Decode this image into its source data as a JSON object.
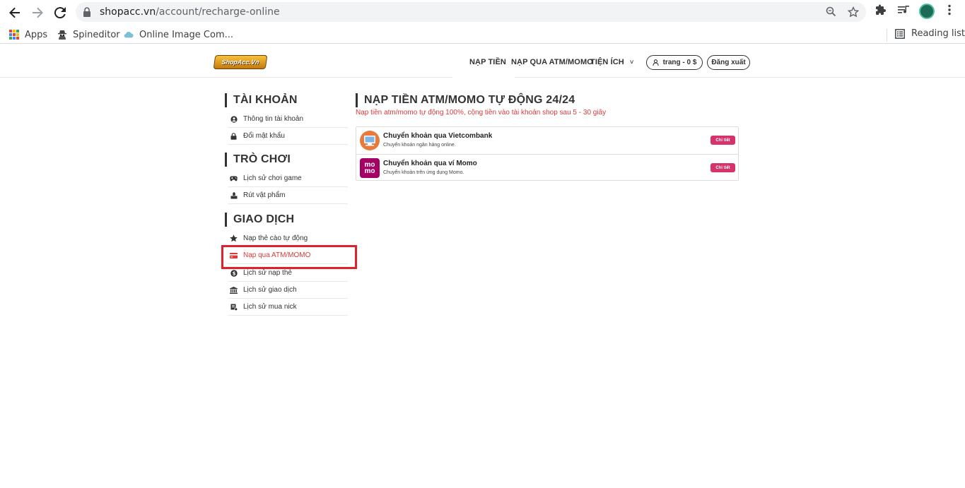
{
  "browser": {
    "url_host": "shopacc.vn",
    "url_path": "/account/recharge-online",
    "bookmarks": [
      {
        "label": "Apps"
      },
      {
        "label": "Spineditor"
      },
      {
        "label": "Online Image Com..."
      }
    ],
    "reading_list": "Reading list"
  },
  "header": {
    "logo_text": "ShopAcc.Vn",
    "menu": [
      {
        "label": "NẠP TIỀN"
      },
      {
        "label": "NẠP QUA ATM/MOMO"
      },
      {
        "label": "TIỆN ÍCH"
      }
    ],
    "tienich_caret": "˅",
    "user_label": "trang - 0 $",
    "logout_label": "Đăng xuất"
  },
  "sidebar": {
    "sections": [
      {
        "title": "TÀI KHOẢN",
        "items": [
          {
            "label": "Thông tin tài khoản",
            "icon": "user-circle-icon"
          },
          {
            "label": "Đổi mật khẩu",
            "icon": "lock-icon"
          }
        ]
      },
      {
        "title": "TRÒ CHƠI",
        "items": [
          {
            "label": "Lịch sử chơi game",
            "icon": "gamepad-icon"
          },
          {
            "label": "Rút vật phẩm",
            "icon": "withdraw-icon"
          }
        ]
      },
      {
        "title": "GIAO DỊCH",
        "items": [
          {
            "label": "Nạp thẻ cào tự động",
            "icon": "star-icon"
          },
          {
            "label": "Nạp qua ATM/MOMO",
            "icon": "credit-card-icon",
            "active": true
          },
          {
            "label": "Lịch sử nạp thẻ",
            "icon": "dollar-circle-icon"
          },
          {
            "label": "Lịch sử giao dịch",
            "icon": "bank-icon"
          },
          {
            "label": "Lịch sử mua nick",
            "icon": "cart-icon"
          }
        ]
      }
    ]
  },
  "main": {
    "title": "NẠP TIỀN ATM/MOMO TỰ ĐỘNG 24/24",
    "subtitle": "Nạp tiền atm/momo tự động 100%, cộng tiền vào tài khoản shop sau 5 - 30 giây",
    "methods": [
      {
        "title": "Chuyển khoản qua Vietcombank",
        "desc": "Chuyển khoản ngân hàng online.",
        "button": "Chi tiết"
      },
      {
        "title": "Chuyển khoản qua ví Momo",
        "desc": "Chuyển khoản trên ứng dụng Momo.",
        "button": "Chi tiết",
        "logo_text": "mo mo"
      }
    ]
  },
  "colors": {
    "accent_red": "#d93b3b",
    "highlight_border": "#e3202a",
    "button_pink": "#d6336c",
    "momo_purple": "#a50064"
  }
}
